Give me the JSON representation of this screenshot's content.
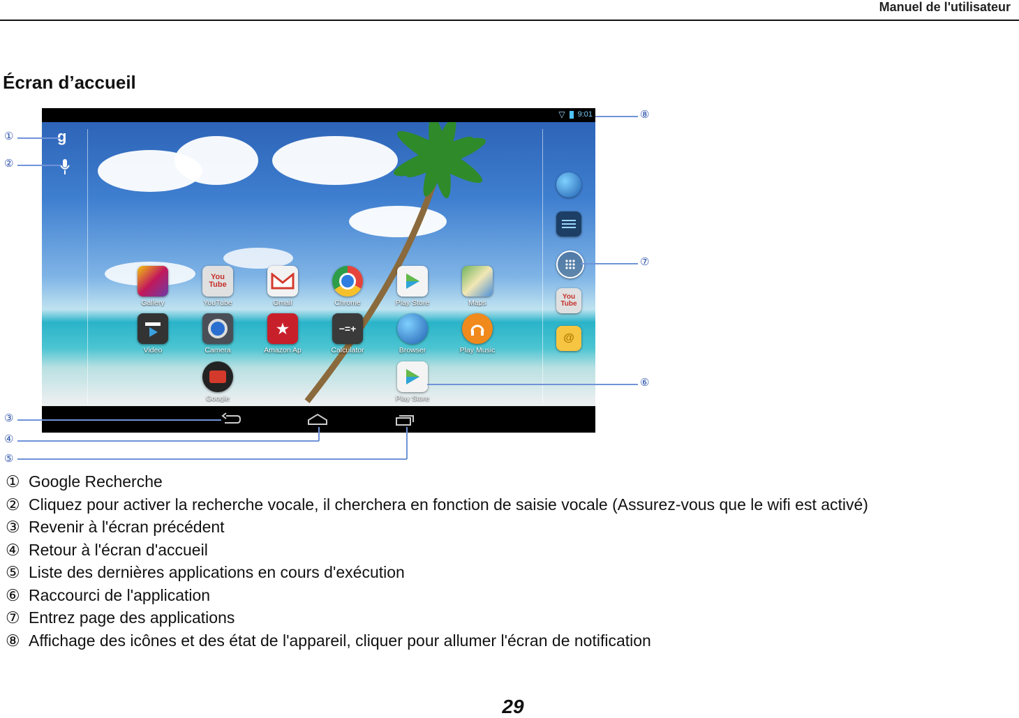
{
  "header": {
    "title": "Manuel de l'utilisateur"
  },
  "section": {
    "title": "Écran d’accueil"
  },
  "tablet": {
    "status_time": "9:01",
    "search_letter": "g",
    "apps": [
      {
        "label": "Gallery",
        "icon": "gallery-icon",
        "color": "#6a3da8"
      },
      {
        "label": "YouTube",
        "icon": "youtube-icon",
        "color": "#e0e0e0"
      },
      {
        "label": "Gmail",
        "icon": "gmail-icon",
        "color": "#f2f2f2"
      },
      {
        "label": "Chrome",
        "icon": "chrome-icon",
        "color": "#e6443a"
      },
      {
        "label": "Play Store",
        "icon": "play-store-icon",
        "color": "#f4f4f4"
      },
      {
        "label": "Maps",
        "icon": "maps-icon",
        "color": "#6fb35a"
      },
      {
        "label": "Video",
        "icon": "video-icon",
        "color": "#333333"
      },
      {
        "label": "Camera",
        "icon": "camera-icon",
        "color": "#4a4f57"
      },
      {
        "label": "Amazon Ap",
        "icon": "amazon-app-icon",
        "color": "#c8202b"
      },
      {
        "label": "Calculator",
        "icon": "calculator-icon",
        "color": "#3a3a3a"
      },
      {
        "label": "Browser",
        "icon": "browser-icon",
        "color": "#2b7fc6"
      },
      {
        "label": "Play Music",
        "icon": "play-music-icon",
        "color": "#f08a1c"
      },
      {
        "label": "Google",
        "icon": "google-folder-icon",
        "color": "#d33a2c"
      },
      {
        "label": "Play Store",
        "icon": "play-store-icon",
        "color": "#f4f4f4"
      }
    ],
    "youtube_text": "You Tube",
    "calc_text": "−=+",
    "email_symbol": "@"
  },
  "callouts": [
    "①",
    "②",
    "③",
    "④",
    "⑤",
    "⑥",
    "⑦",
    "⑧"
  ],
  "legend": [
    {
      "num": "①",
      "text": "Google Recherche"
    },
    {
      "num": "②",
      "text": "Cliquez pour activer la recherche vocale, il cherchera en fonction de saisie vocale (Assurez-vous que le wifi est activé)"
    },
    {
      "num": "③",
      "text": "Revenir à l'écran précédent"
    },
    {
      "num": "④",
      "text": "Retour à l'écran d'accueil"
    },
    {
      "num": "⑤",
      "text": "Liste des dernières applications en cours d'exécution"
    },
    {
      "num": "⑥",
      "text": "Raccourci de l'application"
    },
    {
      "num": "⑦",
      "text": "Entrez page des applications"
    },
    {
      "num": "⑧",
      "text": "Affichage des icônes et des état de l'appareil, cliquer pour allumer l'écran de notification"
    }
  ],
  "page_number": "29"
}
